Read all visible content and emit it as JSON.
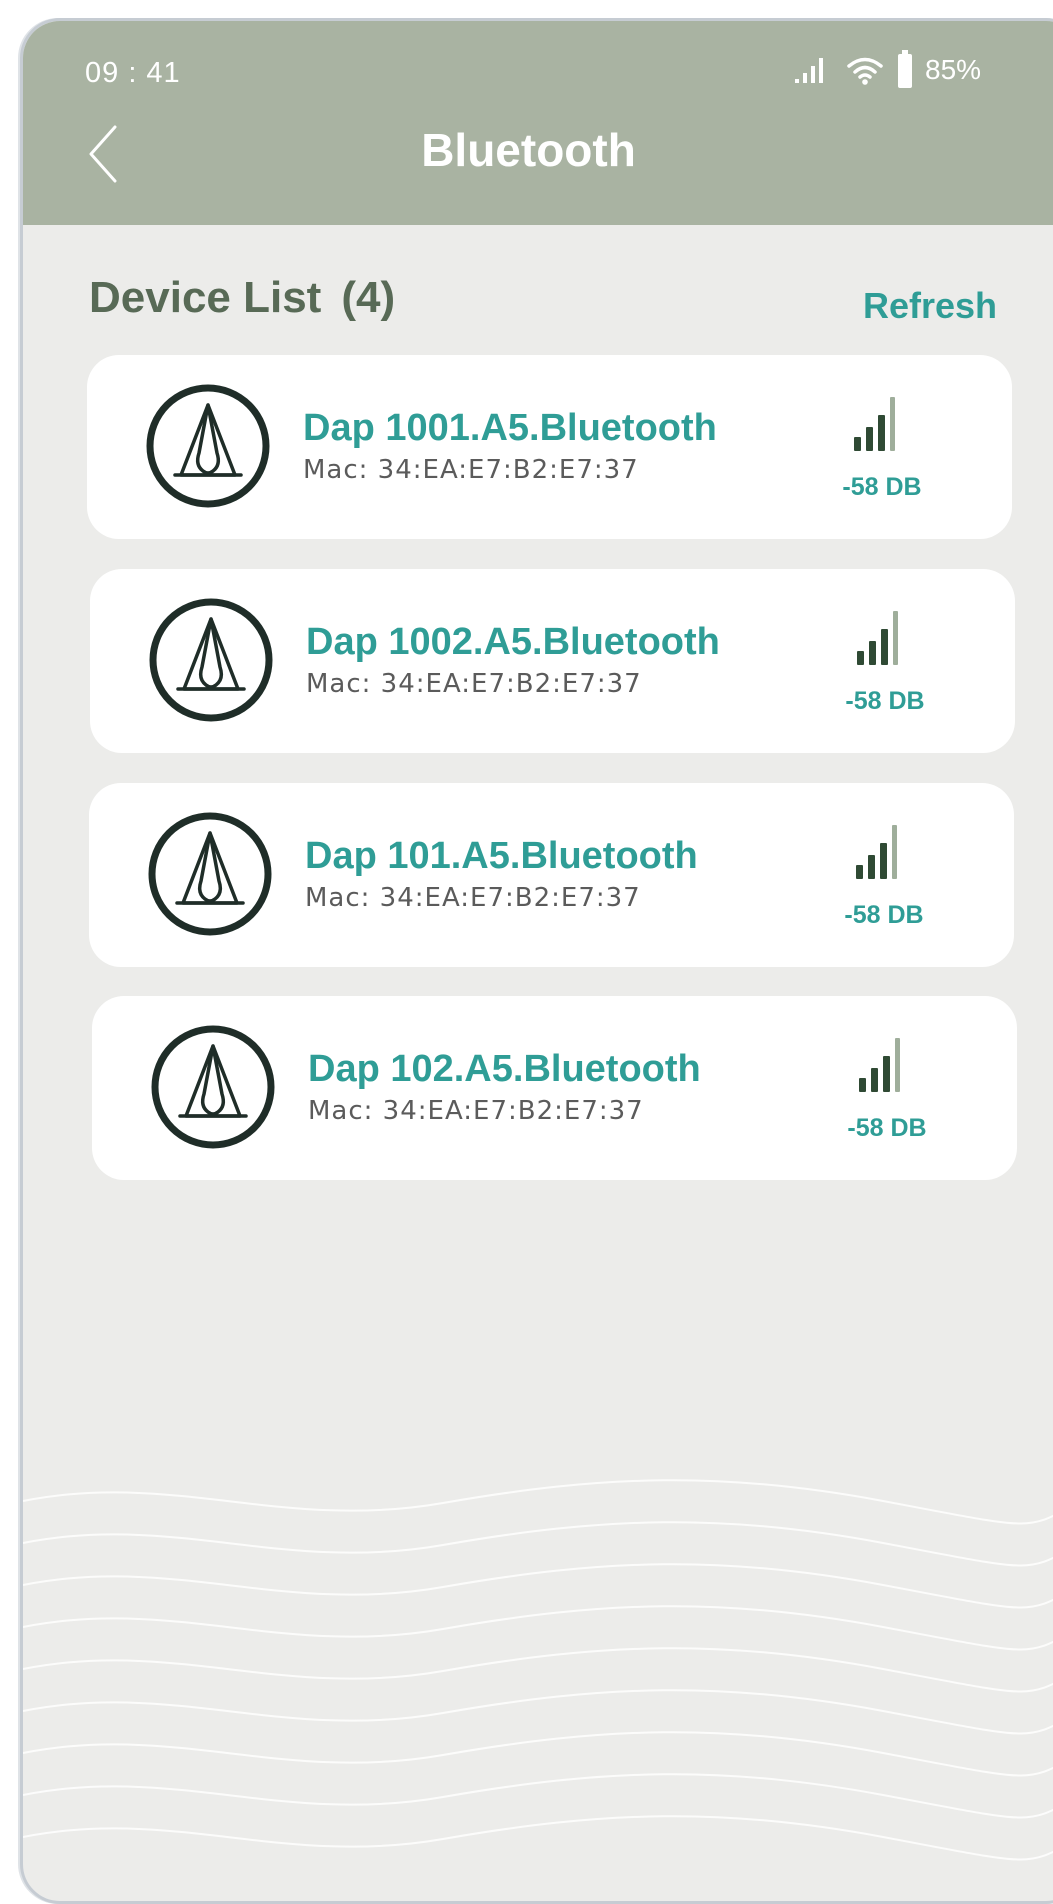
{
  "status_bar": {
    "time": "09 : 41",
    "battery": "85%"
  },
  "header": {
    "title": "Bluetooth"
  },
  "device_list": {
    "title": "Device List",
    "count": "(4)",
    "refresh_label": "Refresh",
    "devices": [
      {
        "name": "Dap 1001.A5.Bluetooth",
        "mac": "Mac: 34:EA:E7:B2:E7:37",
        "signal": "-58 DB"
      },
      {
        "name": "Dap 1002.A5.Bluetooth",
        "mac": "Mac: 34:EA:E7:B2:E7:37",
        "signal": "-58 DB"
      },
      {
        "name": "Dap 101.A5.Bluetooth",
        "mac": "Mac: 34:EA:E7:B2:E7:37",
        "signal": "-58 DB"
      },
      {
        "name": "Dap 102.A5.Bluetooth",
        "mac": "Mac: 34:EA:E7:B2:E7:37",
        "signal": "-58 DB"
      }
    ]
  },
  "colors": {
    "header_bg": "#a9b3a2",
    "accent": "#2f9d96",
    "section_title": "#586a56",
    "card_bg": "#ffffff",
    "page_bg": "#ececea"
  },
  "icons": [
    "chevron-left-icon",
    "cellular-signal-icon",
    "wifi-icon",
    "battery-icon",
    "device-logo-icon",
    "signal-strength-icon"
  ]
}
